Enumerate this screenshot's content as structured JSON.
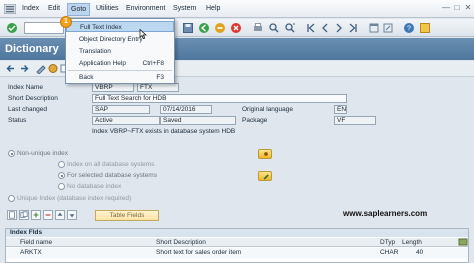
{
  "menubar": {
    "items": [
      "Index",
      "Edit",
      "Goto",
      "Utilities",
      "Environment",
      "System",
      "Help"
    ],
    "active": "Goto"
  },
  "title": "Dictionary",
  "goto_menu": {
    "items": [
      {
        "label": "Full Text Index",
        "shortcut": ""
      },
      {
        "label": "Object Directory Entry",
        "shortcut": ""
      },
      {
        "label": "Translation",
        "shortcut": ""
      },
      {
        "label": "Application Help",
        "shortcut": "Ctrl+F8"
      },
      {
        "label": "Back",
        "shortcut": "F3"
      }
    ],
    "step_badge": "1"
  },
  "form": {
    "index_name": {
      "label": "Index Name",
      "table": "VBRP",
      "index": "FTX"
    },
    "short_description": {
      "label": "Short Description",
      "value": "Full Text Search for HDB"
    },
    "last_changed": {
      "label": "Last changed",
      "user": "SAP",
      "date": "07/14/2016",
      "orig_lang_label": "Original language",
      "orig_lang": "EN"
    },
    "status": {
      "label": "Status",
      "value": "Active",
      "saved": "Saved",
      "package_label": "Package",
      "package": "VF"
    },
    "info_line": "Index VBRP~FTX exists in database system HDB",
    "non_unique": "Non-unique index",
    "opt_all": "Index on all database systems",
    "opt_selected": "For selected database systems",
    "opt_none": "No database index",
    "unique": "Unique Index (database index required)"
  },
  "table_fields_button": "Table Fields",
  "watermark": "www.saplearners.com",
  "table": {
    "title": "Index Flds",
    "headers": [
      "Field name",
      "Short Description",
      "DTyp",
      "Length"
    ],
    "rows": [
      {
        "field": "ARKTX",
        "desc": "Short text for sales order item",
        "dtyp": "CHAR",
        "length": "40"
      }
    ]
  }
}
